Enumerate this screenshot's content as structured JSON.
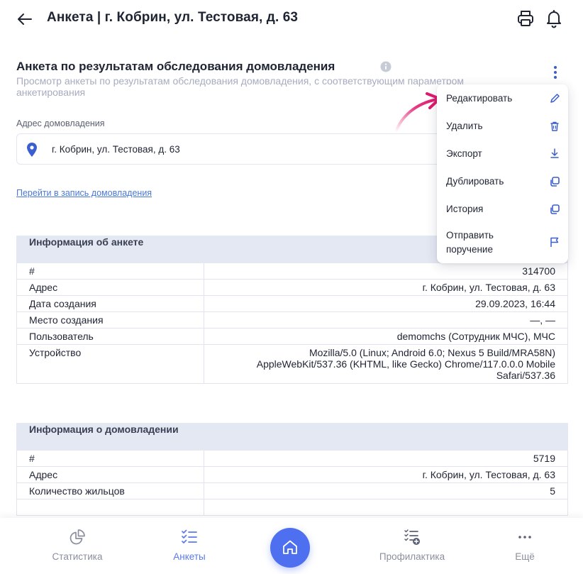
{
  "header": {
    "title": "Анкета |  г. Кобрин, ул. Тестовая, д. 63"
  },
  "section": {
    "title": "Анкета по результатам обследования домовладения",
    "subtitle": "Просмотр анкеты по результатам обследования домовладения, с соответствующим параметром анкетирования"
  },
  "address_field": {
    "label": "Адрес домовладения",
    "value": "г. Кобрин, ул. Тестовая, д. 63"
  },
  "goto_link": "Перейти в запись домовладения",
  "menu": {
    "items": [
      {
        "label": "Редактировать",
        "icon": "pencil-icon"
      },
      {
        "label": "Удалить",
        "icon": "trash-icon"
      },
      {
        "label": "Экспорт",
        "icon": "download-icon"
      },
      {
        "label": "Дублировать",
        "icon": "copy-icon"
      },
      {
        "label": "История",
        "icon": "copy-icon"
      },
      {
        "label": "Отправить\nпоручение",
        "icon": "flag-icon"
      }
    ]
  },
  "survey_info": {
    "heading": "Информация об анкете",
    "rows": [
      {
        "key": "#",
        "value": "314700"
      },
      {
        "key": "Адрес",
        "value": "г. Кобрин, ул. Тестовая, д. 63"
      },
      {
        "key": "Дата создания",
        "value": "29.09.2023, 16:44"
      },
      {
        "key": "Место создания",
        "value": "—, —"
      },
      {
        "key": "Пользователь",
        "value": "demomchs (Сотрудник МЧС), МЧС"
      },
      {
        "key": "Устройство",
        "value": "Mozilla/5.0 (Linux; Android 6.0; Nexus 5 Build/MRA58N) AppleWebKit/537.36 (KHTML, like Gecko) Chrome/117.0.0.0 Mobile Safari/537.36"
      }
    ]
  },
  "household_info": {
    "heading": "Информация о домовладении",
    "rows": [
      {
        "key": "#",
        "value": "5719"
      },
      {
        "key": "Адрес",
        "value": "г. Кобрин, ул. Тестовая, д. 63"
      },
      {
        "key": "Количество жильцов",
        "value": "5"
      }
    ]
  },
  "bottom_nav": {
    "items": [
      {
        "label": "Статистика",
        "icon": "pie-chart-icon",
        "active": false
      },
      {
        "label": "Анкеты",
        "icon": "checklist-icon",
        "active": true
      },
      {
        "label": "Профилактика",
        "icon": "checklist-add-icon",
        "active": false
      },
      {
        "label": "Ещё",
        "icon": "more-icon",
        "active": false
      }
    ],
    "home_icon": "home-icon"
  },
  "colors": {
    "accent": "#4d6ff0",
    "active_nav": "#5a7ae8",
    "table_header_bg": "#e4e8f2",
    "annotation_arrow": "#e0196e"
  }
}
